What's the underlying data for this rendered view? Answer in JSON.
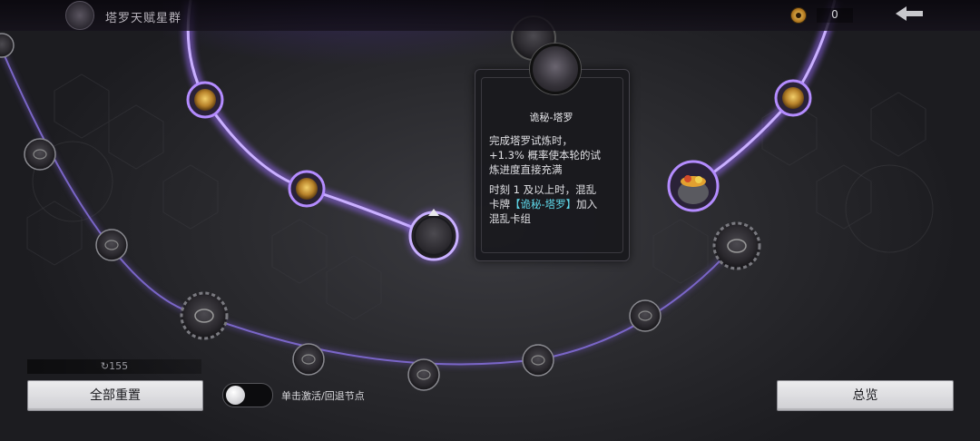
{
  "header": {
    "title": "塔罗天赋星群",
    "currency_value": "0",
    "back_icon": "back-arrow-icon"
  },
  "tooltip": {
    "title": "诡秘-塔罗",
    "line1": "完成塔罗试炼时，",
    "line2": "+1.3% 概率使本轮的试",
    "line3": "炼进度直接充满",
    "line4": "时刻 1 及以上时，混乱",
    "line5_prefix": "卡牌",
    "line5_link": "【诡秘-塔罗】",
    "line5_suffix": "加入",
    "line6": "混乱卡组",
    "link_color": "#5fd8ea"
  },
  "controls": {
    "cost_value": "155",
    "reset_label": "全部重置",
    "toggle_label": "单击激活/回退节点",
    "toggle_on": false,
    "overview_label": "总览"
  },
  "colors": {
    "active_path": "#9b6dff",
    "inactive_path": "#6a55a8",
    "node_border_active": "#b48cff"
  }
}
